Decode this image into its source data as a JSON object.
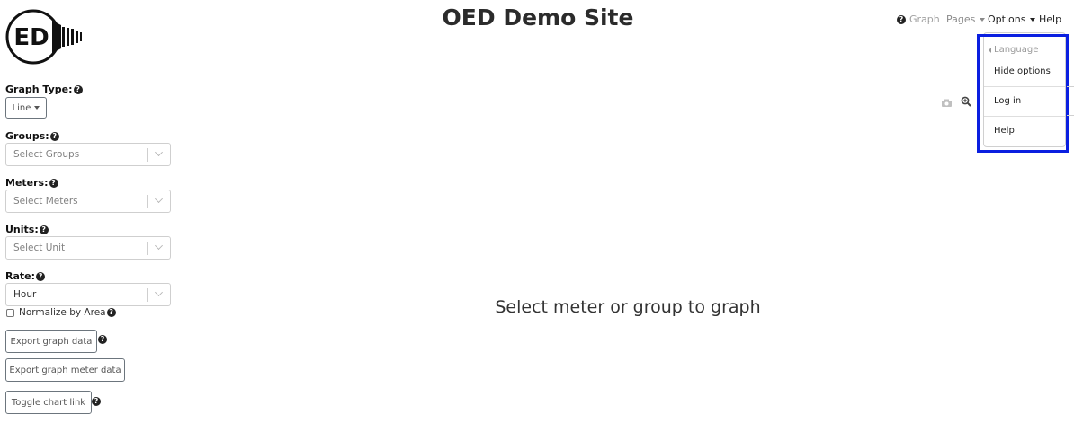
{
  "site": {
    "title": "OED Demo Site",
    "logo_text": "ED"
  },
  "nav": {
    "graph": "Graph",
    "pages": "Pages",
    "options": "Options",
    "help": "Help"
  },
  "options_menu": {
    "language": "Language",
    "hide_options": "Hide options",
    "log_in": "Log in",
    "help": "Help"
  },
  "sidebar": {
    "graph_type_label": "Graph Type:",
    "graph_type_value": "Line",
    "groups_label": "Groups:",
    "groups_placeholder": "Select Groups",
    "meters_label": "Meters:",
    "meters_placeholder": "Select Meters",
    "units_label": "Units:",
    "units_placeholder": "Select Unit",
    "rate_label": "Rate:",
    "rate_value": "Hour",
    "normalize_label": "Normalize by Area",
    "export_graph_data": "Export graph data",
    "export_graph_meter_data": "Export graph meter data",
    "toggle_chart_link": "Toggle chart link"
  },
  "main": {
    "empty_message": "Select meter or group to graph"
  },
  "colors": {
    "highlight": "#0a1fe0"
  },
  "icons": [
    "question-circle-icon",
    "camera-icon",
    "zoom-icon",
    "caret-down-icon",
    "caret-left-icon",
    "chevron-down-icon"
  ]
}
